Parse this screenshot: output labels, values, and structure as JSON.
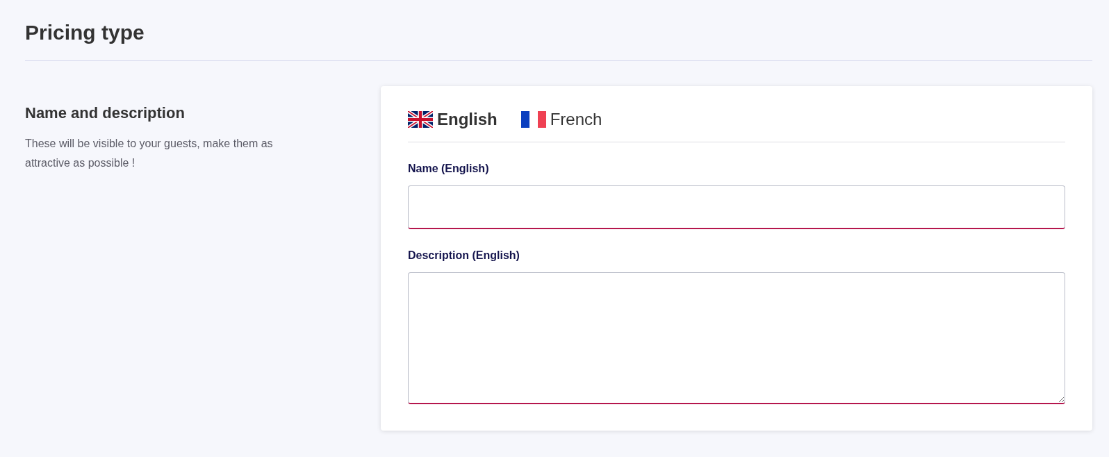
{
  "page_title": "Pricing type",
  "section": {
    "title": "Name and description",
    "description": "These will be visible to your guests, make them as attractive as possible !"
  },
  "language_tabs": [
    {
      "label": "English",
      "kind": "uk",
      "selected": true
    },
    {
      "label": "French",
      "kind": "fr",
      "selected": false
    }
  ],
  "fields": [
    {
      "kind": "input",
      "label": "Name (English)",
      "invalid": true
    },
    {
      "kind": "textarea",
      "label": "Description (English)",
      "invalid": true
    }
  ]
}
